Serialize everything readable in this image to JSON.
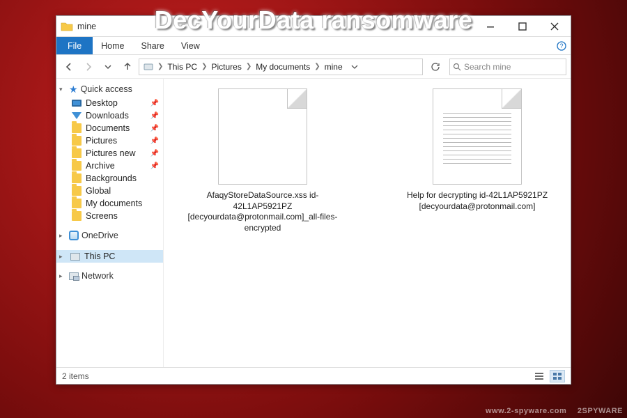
{
  "page_heading": "DecYourData ransomware",
  "watermark_left": "www.2-spyware.com",
  "watermark_right": "2SPYWARE",
  "window": {
    "title": "mine",
    "ribbon": {
      "file": "File",
      "home": "Home",
      "share": "Share",
      "view": "View"
    },
    "breadcrumb": [
      "This PC",
      "Pictures",
      "My documents",
      "mine"
    ],
    "search_placeholder": "Search mine",
    "status": {
      "count": "2 items"
    }
  },
  "sidebar": {
    "quick_access": "Quick access",
    "items": [
      {
        "label": "Desktop",
        "pinned": true
      },
      {
        "label": "Downloads",
        "pinned": true
      },
      {
        "label": "Documents",
        "pinned": true
      },
      {
        "label": "Pictures",
        "pinned": true
      },
      {
        "label": "Pictures new",
        "pinned": true
      },
      {
        "label": "Archive",
        "pinned": true
      },
      {
        "label": "Backgrounds",
        "pinned": false
      },
      {
        "label": "Global",
        "pinned": false
      },
      {
        "label": "My documents",
        "pinned": false
      },
      {
        "label": "Screens",
        "pinned": false
      }
    ],
    "onedrive": "OneDrive",
    "this_pc": "This PC",
    "network": "Network"
  },
  "files": [
    {
      "name": "AfaqyStoreDataSource.xss id-42L1AP5921PZ [decyourdata@protonmail.com]_all-files-encrypted",
      "type": "blank"
    },
    {
      "name": "Help for decrypting id-42L1AP5921PZ [decyourdata@protonmail.com]",
      "type": "text"
    }
  ]
}
